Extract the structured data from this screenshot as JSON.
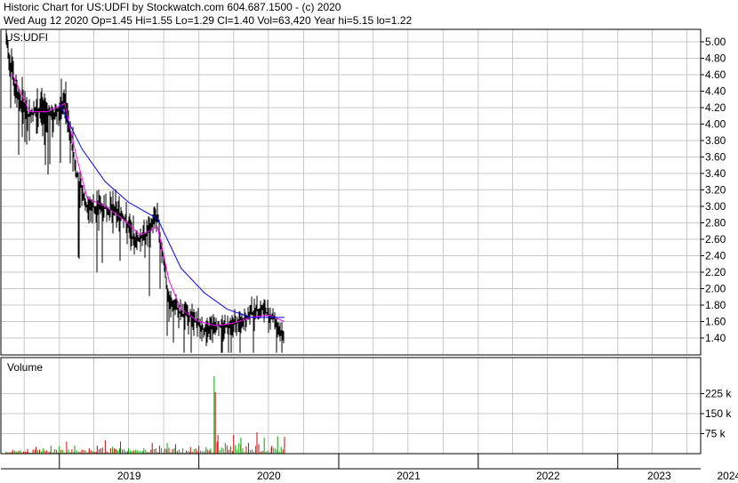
{
  "header": {
    "line1": "Historic Chart for US:UDFI by Stockwatch.com 604.687.1500 - (c) 2020",
    "line2": "Wed Aug 12 2020   Op=1.45   Hi=1.55   Lo=1.29   Cl=1.40   Vol=63,420   Year hi=5.15   lo=1.22"
  },
  "price_panel": {
    "symbol_label": "US:UDFI"
  },
  "volume_panel": {
    "label": "Volume"
  },
  "colors": {
    "background": "#ffffff",
    "grid": "#c8c8c8",
    "price_bars": "#000000",
    "ma_short": "#ff00ff",
    "ma_long": "#0000ff",
    "volume_up": "#00aa00",
    "volume_down": "#dd0000"
  },
  "chart_data": [
    {
      "type": "ohlc",
      "title": "US:UDFI",
      "x_axis": {
        "type": "time",
        "labels": [
          "2019",
          "2020",
          "2021",
          "2022",
          "2023",
          "2024"
        ]
      },
      "y_axis": {
        "ticks": [
          "5.00",
          "4.80",
          "4.60",
          "4.40",
          "4.20",
          "4.00",
          "3.80",
          "3.60",
          "3.40",
          "3.20",
          "3.00",
          "2.80",
          "2.60",
          "2.40",
          "2.20",
          "2.00",
          "1.80",
          "1.60",
          "1.40"
        ],
        "ylim": [
          1.22,
          5.15
        ]
      },
      "grid": true,
      "series": [
        {
          "name": "price",
          "points": [
            [
              "2018-08-15",
              5.0
            ],
            [
              "2018-09-15",
              4.3
            ],
            [
              "2018-10-15",
              4.1
            ],
            [
              "2018-11-15",
              4.2
            ],
            [
              "2018-12-15",
              4.1
            ],
            [
              "2019-01-15",
              4.3
            ],
            [
              "2019-02-15",
              3.4
            ],
            [
              "2019-03-15",
              3.0
            ],
            [
              "2019-04-15",
              3.0
            ],
            [
              "2019-05-15",
              2.95
            ],
            [
              "2019-06-15",
              2.9
            ],
            [
              "2019-07-15",
              2.6
            ],
            [
              "2019-08-15",
              2.65
            ],
            [
              "2019-09-15",
              2.9
            ],
            [
              "2019-10-15",
              1.85
            ],
            [
              "2019-11-15",
              1.7
            ],
            [
              "2019-12-15",
              1.65
            ],
            [
              "2020-01-15",
              1.5
            ],
            [
              "2020-02-15",
              1.55
            ],
            [
              "2020-03-15",
              1.55
            ],
            [
              "2020-04-15",
              1.6
            ],
            [
              "2020-05-15",
              1.7
            ],
            [
              "2020-06-15",
              1.75
            ],
            [
              "2020-07-15",
              1.65
            ],
            [
              "2020-08-12",
              1.4
            ]
          ]
        },
        {
          "name": "",
          "points": [
            [
              "2018-09-01",
              4.6
            ],
            [
              "2018-10-15",
              4.15
            ],
            [
              "2018-12-01",
              4.15
            ],
            [
              "2019-01-15",
              4.25
            ],
            [
              "2019-02-15",
              3.6
            ],
            [
              "2019-03-15",
              3.1
            ],
            [
              "2019-05-01",
              3.0
            ],
            [
              "2019-06-15",
              2.85
            ],
            [
              "2019-08-01",
              2.65
            ],
            [
              "2019-09-15",
              2.75
            ],
            [
              "2019-10-15",
              2.1
            ],
            [
              "2019-11-15",
              1.75
            ],
            [
              "2020-01-01",
              1.6
            ],
            [
              "2020-02-15",
              1.55
            ],
            [
              "2020-04-01",
              1.58
            ],
            [
              "2020-05-15",
              1.65
            ],
            [
              "2020-07-01",
              1.68
            ],
            [
              "2020-08-12",
              1.6
            ]
          ]
        },
        {
          "name": "",
          "points": [
            [
              "2019-01-01",
              4.25
            ],
            [
              "2019-03-01",
              3.7
            ],
            [
              "2019-05-01",
              3.3
            ],
            [
              "2019-07-01",
              3.05
            ],
            [
              "2019-09-15",
              2.85
            ],
            [
              "2019-11-15",
              2.25
            ],
            [
              "2020-01-15",
              1.95
            ],
            [
              "2020-03-15",
              1.75
            ],
            [
              "2020-05-15",
              1.65
            ],
            [
              "2020-08-12",
              1.65
            ]
          ]
        }
      ]
    },
    {
      "type": "bar",
      "title": "Volume",
      "y_axis": {
        "ticks": [
          "225 k",
          "150 k",
          "75 k"
        ],
        "ylim": [
          0,
          300
        ]
      },
      "series": [
        {
          "name": "Volume",
          "unit": "k",
          "points": [
            [
              "2018-08-15",
              8,
              "up"
            ],
            [
              "2018-09-01",
              14,
              "down"
            ],
            [
              "2018-09-20",
              12,
              "up"
            ],
            [
              "2018-10-10",
              18,
              "down"
            ],
            [
              "2018-11-01",
              25,
              "down"
            ],
            [
              "2018-11-20",
              20,
              "up"
            ],
            [
              "2018-12-10",
              30,
              "up"
            ],
            [
              "2019-01-01",
              28,
              "up"
            ],
            [
              "2019-01-20",
              45,
              "down"
            ],
            [
              "2019-02-10",
              30,
              "up"
            ],
            [
              "2019-03-01",
              15,
              "down"
            ],
            [
              "2019-03-20",
              20,
              "down"
            ],
            [
              "2019-04-10",
              30,
              "down"
            ],
            [
              "2019-05-01",
              50,
              "down"
            ],
            [
              "2019-05-20",
              25,
              "up"
            ],
            [
              "2019-06-10",
              45,
              "down"
            ],
            [
              "2019-07-01",
              20,
              "up"
            ],
            [
              "2019-07-20",
              15,
              "up"
            ],
            [
              "2019-08-10",
              20,
              "up"
            ],
            [
              "2019-09-01",
              40,
              "down"
            ],
            [
              "2019-09-20",
              30,
              "down"
            ],
            [
              "2019-10-10",
              40,
              "up"
            ],
            [
              "2019-11-01",
              35,
              "down"
            ],
            [
              "2019-11-20",
              20,
              "up"
            ],
            [
              "2019-12-10",
              25,
              "down"
            ],
            [
              "2020-01-01",
              30,
              "down"
            ],
            [
              "2020-01-20",
              25,
              "up"
            ],
            [
              "2020-02-01",
              20,
              "up"
            ],
            [
              "2020-02-10",
              290,
              "up"
            ],
            [
              "2020-02-13",
              230,
              "down"
            ],
            [
              "2020-02-20",
              70,
              "down"
            ],
            [
              "2020-03-10",
              40,
              "up"
            ],
            [
              "2020-04-01",
              70,
              "down"
            ],
            [
              "2020-04-20",
              60,
              "up"
            ],
            [
              "2020-05-10",
              40,
              "down"
            ],
            [
              "2020-06-01",
              80,
              "down"
            ],
            [
              "2020-06-20",
              60,
              "up"
            ],
            [
              "2020-07-10",
              30,
              "down"
            ],
            [
              "2020-07-25",
              65,
              "up"
            ],
            [
              "2020-08-12",
              63,
              "down"
            ]
          ]
        }
      ]
    }
  ]
}
